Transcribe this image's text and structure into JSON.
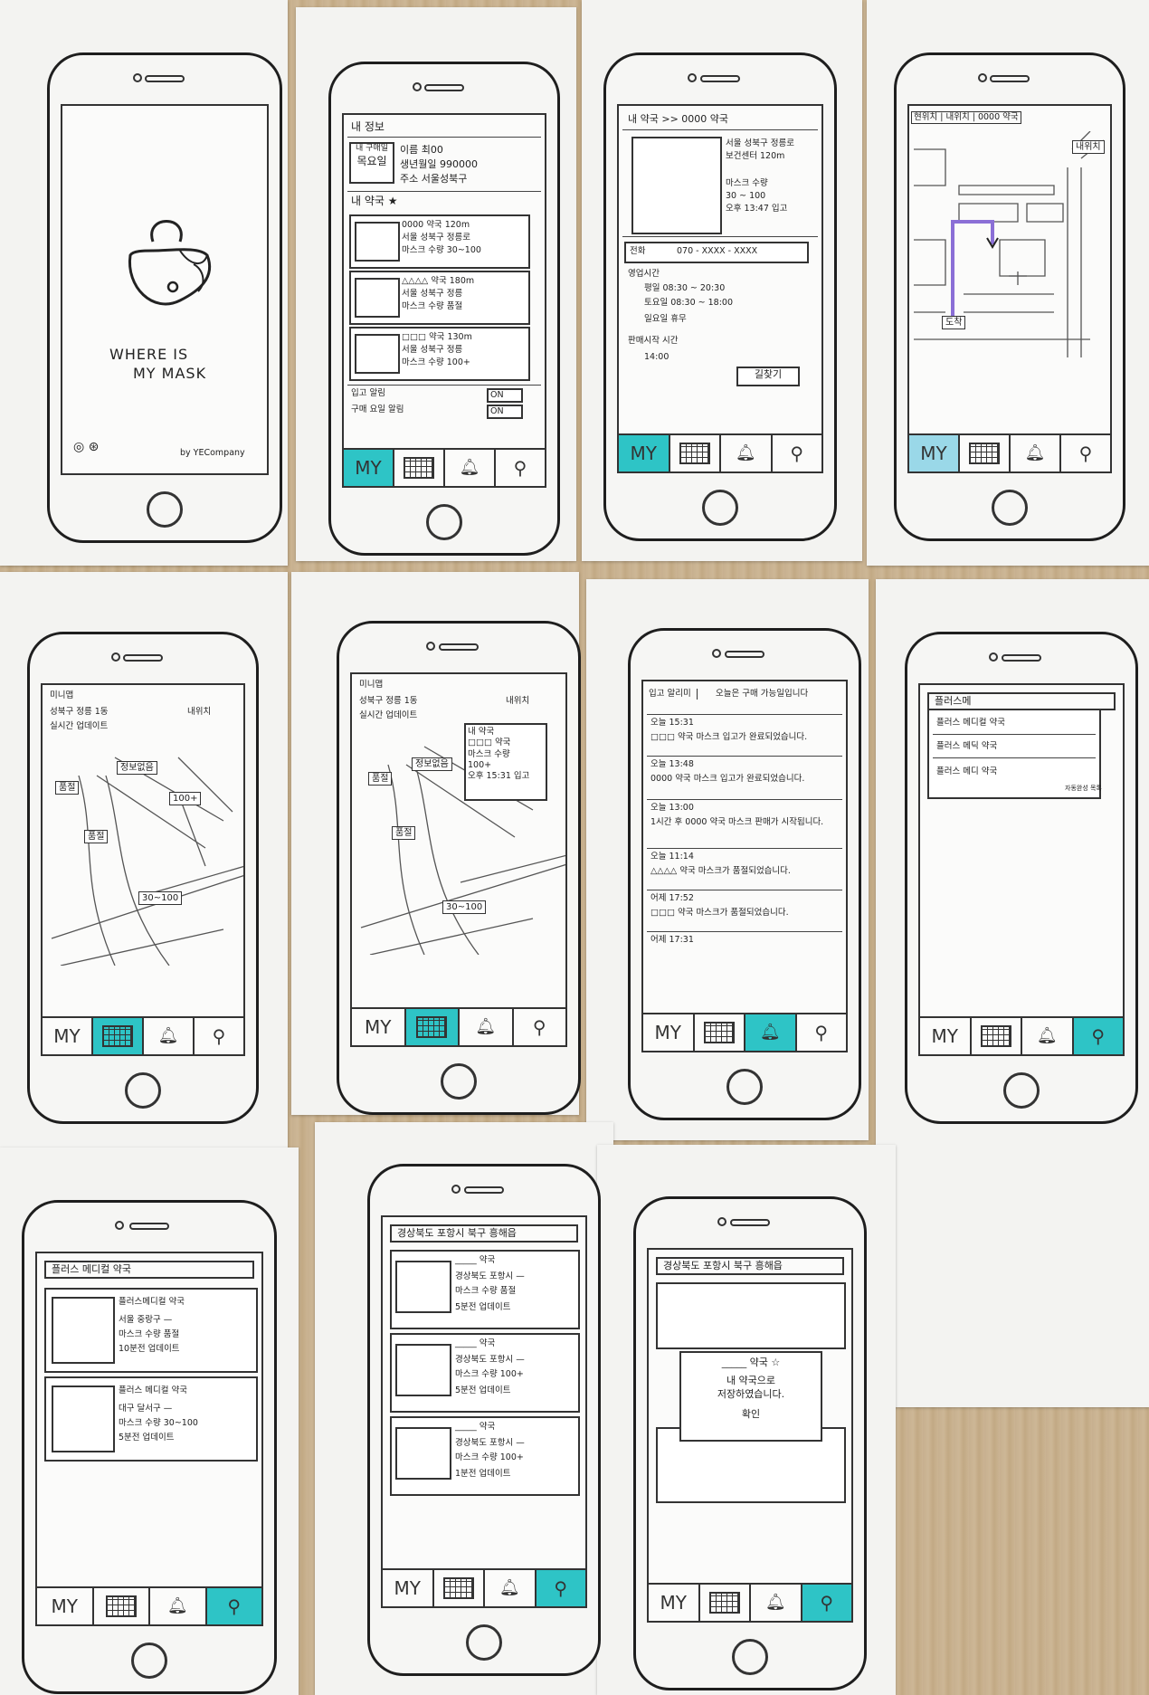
{
  "tabs": {
    "my": "MY",
    "grid": "",
    "bell": "",
    "search": ""
  },
  "s1": {
    "title_line1": "WHERE IS",
    "title_line2": "MY MASK",
    "credit": "by YECompany"
  },
  "s2": {
    "header": "내 정보",
    "day_label": "내 구매일",
    "day_value": "목요일",
    "name": "이름 최00",
    "birth": "생년월일 990000",
    "addr": "주소 서울성북구",
    "my_pharmacy": "내 약국 ★",
    "items": [
      {
        "name": "0000 약국 120m",
        "sub": "서울 성북구 정릉로",
        "mask": "마스크 수량 30~100"
      },
      {
        "name": "△△△△ 약국 180m",
        "sub": "서울 성북구 정릉",
        "mask": "마스크 수량 품절"
      },
      {
        "name": "□□□ 약국 130m",
        "sub": "서울 성북구 정릉",
        "mask": "마스크 수량 100+"
      }
    ],
    "alarm1": "입고 알림",
    "alarm1_val": "ON",
    "alarm2": "구매 요일 알림",
    "alarm2_val": "ON"
  },
  "s3": {
    "breadcrumb": "내 약국 >> 0000 약국",
    "addr": "서울 성북구 정릉로",
    "addr2": "보건센터 120m",
    "mask": "마스크 수량",
    "range": "30 ~ 100",
    "updated": "오후 13:47 입고",
    "phone_label": "전화",
    "phone": "070 - XXXX - XXXX",
    "hours_label": "영업시간",
    "weekday": "평일 08:30 ~ 20:30",
    "sat": "토요일 08:30 ~ 18:00",
    "sun": "일요일 휴무",
    "sale_label": "판매시작 시간",
    "sale_time": "14:00",
    "find_btn": "길찾기"
  },
  "s4": {
    "search_left": "현위치",
    "search_mid": "내위치",
    "search_right": "0000 약국",
    "me": "내위치",
    "dest": "도착"
  },
  "s5": {
    "header": "미니맵",
    "loc": "성북구 정릉 1동",
    "mylocation": "내위치",
    "update": "실시간 업데이트",
    "pins": [
      "품절",
      "정보없음",
      "품절",
      "100+",
      "30~100"
    ]
  },
  "s6": {
    "header": "미니맵",
    "loc": "성북구 정릉 1동",
    "mylocation": "내위치",
    "update": "실시간 업데이트",
    "popup_star": "내 약국",
    "popup_name": "□□□ 약국",
    "popup_mask": "마스크 수량",
    "popup_count": "100+",
    "popup_time": "오후 15:31 입고",
    "pins": [
      "품절",
      "정보없음",
      "품절",
      "30~100"
    ]
  },
  "s7": {
    "header_left": "입고 알리미",
    "header_right": "오늘은 구매 가능일입니다",
    "entries": [
      {
        "time": "오늘 15:31",
        "text": "□□□ 약국 마스크 입고가 완료되었습니다."
      },
      {
        "time": "오늘 13:48",
        "text": "0000 약국 마스크 입고가 완료되었습니다."
      },
      {
        "time": "오늘 13:00",
        "text": "1시간 후 0000 약국 마스크 판매가 시작됩니다."
      },
      {
        "time": "오늘 11:14",
        "text": "△△△△ 약국 마스크가 품절되었습니다."
      },
      {
        "time": "어제 17:52",
        "text": "□□□ 약국 마스크가 품절되었습니다."
      },
      {
        "time": "어제 17:31",
        "text": ""
      }
    ]
  },
  "s8": {
    "query": "플러스메",
    "suggestions": [
      "플러스 메디컬 약국",
      "플러스 메딕 약국",
      "플러스 메디 약국"
    ],
    "note": "자동완성 목록"
  },
  "s9": {
    "query": "플러스 메디컬 약국",
    "results": [
      {
        "name": "플러스메디컬 약국",
        "addr": "서울 중랑구 —",
        "mask": "마스크 수량 품절",
        "update": "10분전 업데이트"
      },
      {
        "name": "플러스 메디컬 약국",
        "addr": "대구 달서구 —",
        "mask": "마스크 수량 30~100",
        "update": "5분전 업데이트"
      }
    ]
  },
  "s10": {
    "query": "경상북도 포항시 북구 흥해읍",
    "results": [
      {
        "name": "_____ 약국",
        "addr": "경상북도 포항시 —",
        "mask": "마스크 수량 품절",
        "update": "5분전 업데이트"
      },
      {
        "name": "_____ 약국",
        "addr": "경상북도 포항시 —",
        "mask": "마스크 수량 100+",
        "update": "5분전 업데이트"
      },
      {
        "name": "_____ 약국",
        "addr": "경상북도 포항시 —",
        "mask": "마스크 수량 100+",
        "update": "1분전 업데이트"
      }
    ]
  },
  "s11": {
    "query": "경상북도 포항시 북구 흥해읍",
    "dialog_name": "_____ 약국 ☆",
    "dialog_line1": "내 약국으로",
    "dialog_line2": "저장하였습니다.",
    "dialog_ok": "확인"
  }
}
